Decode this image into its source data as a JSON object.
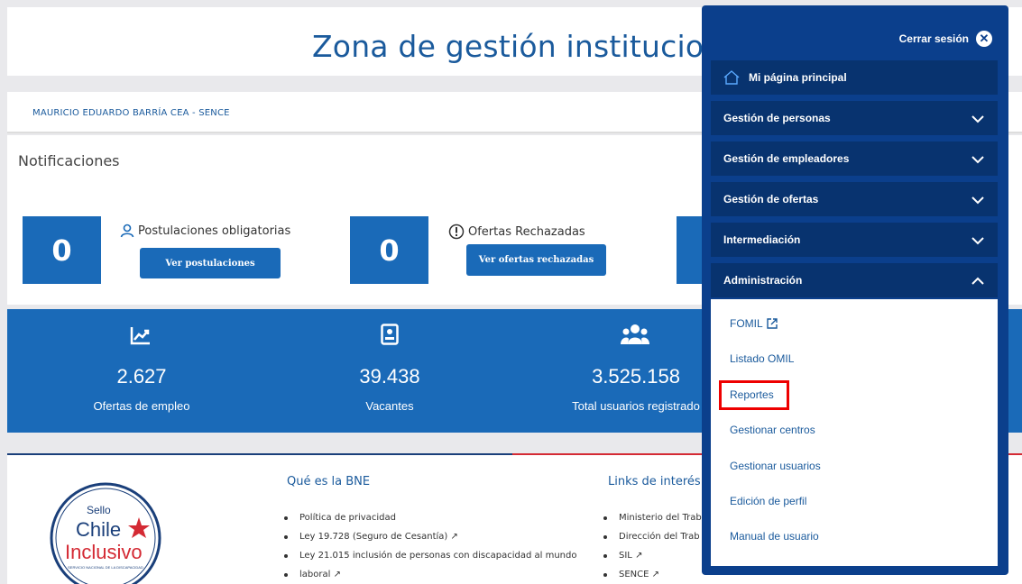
{
  "header": {
    "title": "Zona de gestión institucional"
  },
  "user": {
    "name_line": "MAURICIO EDUARDO BARRÍA CEA -  SENCE"
  },
  "notifications": {
    "title": "Notificaciones",
    "cards": [
      {
        "count": "0",
        "label": "Postulaciones obligatorias",
        "icon": "user-icon",
        "button": "Ver postulaciones"
      },
      {
        "count": "0",
        "label": "Ofertas Rechazadas",
        "icon": "alert-icon",
        "button": "Ver ofertas rechazadas"
      }
    ]
  },
  "stats": [
    {
      "icon": "chart-up-icon",
      "value": "2.627",
      "label": "Ofertas de empleo"
    },
    {
      "icon": "id-card-icon",
      "value": "39.438",
      "label": "Vacantes"
    },
    {
      "icon": "users-icon",
      "value": "3.525.158",
      "label": "Total usuarios registrado"
    }
  ],
  "footer": {
    "logo": {
      "line1": "Sello",
      "line2": "Chile",
      "line3": "Inclusivo",
      "caption": "SERVICIO NACIONAL DE LA DISCAPACIDAD"
    },
    "col1": {
      "title": "Qué es la BNE",
      "items": [
        "Política de privacidad",
        "Ley 19.728 (Seguro de Cesantía)",
        "Ley 21.015 inclusión de personas con discapacidad al mundo",
        "laboral"
      ]
    },
    "col2": {
      "title": "Links de interés",
      "items": [
        "Ministerio del Trab",
        "Dirección del Trab",
        "SIL",
        "SENCE"
      ]
    }
  },
  "menu": {
    "logout": "Cerrar sesión",
    "home": "Mi página principal",
    "sections": [
      {
        "label": "Gestión de personas",
        "expanded": false
      },
      {
        "label": "Gestión de empleadores",
        "expanded": false
      },
      {
        "label": "Gestión de ofertas",
        "expanded": false
      },
      {
        "label": "Intermediación",
        "expanded": false
      },
      {
        "label": "Administración",
        "expanded": true
      }
    ],
    "admin_items": [
      "FOMIL",
      "Listado OMIL",
      "Reportes",
      "Gestionar centros",
      "Gestionar usuarios",
      "Edición de perfil",
      "Manual de usuario"
    ],
    "highlighted_item": "Reportes"
  },
  "colors": {
    "primary": "#1a6ab8",
    "menu": "#0b3f8c",
    "menu_item": "#08336f",
    "highlight": "#ee0000"
  }
}
